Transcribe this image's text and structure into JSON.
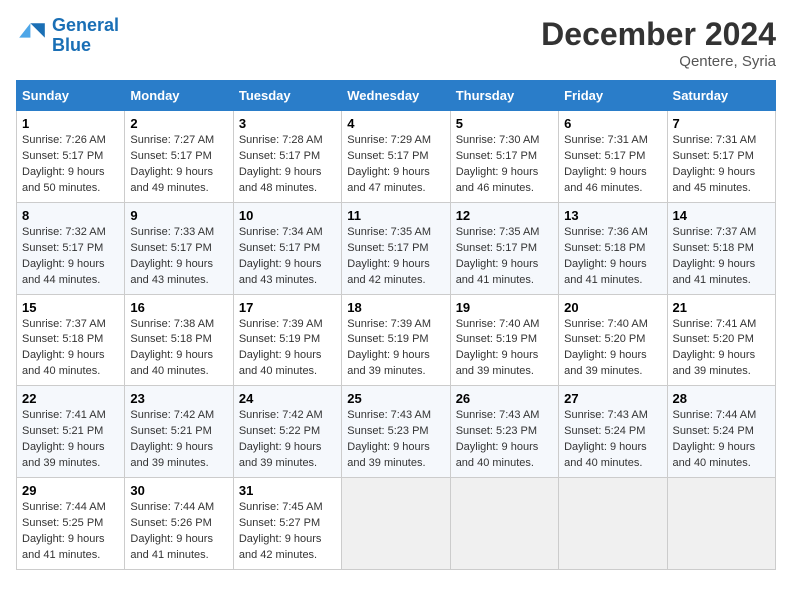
{
  "header": {
    "logo_line1": "General",
    "logo_line2": "Blue",
    "month": "December 2024",
    "location": "Qentere, Syria"
  },
  "columns": [
    "Sunday",
    "Monday",
    "Tuesday",
    "Wednesday",
    "Thursday",
    "Friday",
    "Saturday"
  ],
  "weeks": [
    [
      {
        "day": "1",
        "sunrise": "Sunrise: 7:26 AM",
        "sunset": "Sunset: 5:17 PM",
        "daylight": "Daylight: 9 hours and 50 minutes."
      },
      {
        "day": "2",
        "sunrise": "Sunrise: 7:27 AM",
        "sunset": "Sunset: 5:17 PM",
        "daylight": "Daylight: 9 hours and 49 minutes."
      },
      {
        "day": "3",
        "sunrise": "Sunrise: 7:28 AM",
        "sunset": "Sunset: 5:17 PM",
        "daylight": "Daylight: 9 hours and 48 minutes."
      },
      {
        "day": "4",
        "sunrise": "Sunrise: 7:29 AM",
        "sunset": "Sunset: 5:17 PM",
        "daylight": "Daylight: 9 hours and 47 minutes."
      },
      {
        "day": "5",
        "sunrise": "Sunrise: 7:30 AM",
        "sunset": "Sunset: 5:17 PM",
        "daylight": "Daylight: 9 hours and 46 minutes."
      },
      {
        "day": "6",
        "sunrise": "Sunrise: 7:31 AM",
        "sunset": "Sunset: 5:17 PM",
        "daylight": "Daylight: 9 hours and 46 minutes."
      },
      {
        "day": "7",
        "sunrise": "Sunrise: 7:31 AM",
        "sunset": "Sunset: 5:17 PM",
        "daylight": "Daylight: 9 hours and 45 minutes."
      }
    ],
    [
      {
        "day": "8",
        "sunrise": "Sunrise: 7:32 AM",
        "sunset": "Sunset: 5:17 PM",
        "daylight": "Daylight: 9 hours and 44 minutes."
      },
      {
        "day": "9",
        "sunrise": "Sunrise: 7:33 AM",
        "sunset": "Sunset: 5:17 PM",
        "daylight": "Daylight: 9 hours and 43 minutes."
      },
      {
        "day": "10",
        "sunrise": "Sunrise: 7:34 AM",
        "sunset": "Sunset: 5:17 PM",
        "daylight": "Daylight: 9 hours and 43 minutes."
      },
      {
        "day": "11",
        "sunrise": "Sunrise: 7:35 AM",
        "sunset": "Sunset: 5:17 PM",
        "daylight": "Daylight: 9 hours and 42 minutes."
      },
      {
        "day": "12",
        "sunrise": "Sunrise: 7:35 AM",
        "sunset": "Sunset: 5:17 PM",
        "daylight": "Daylight: 9 hours and 41 minutes."
      },
      {
        "day": "13",
        "sunrise": "Sunrise: 7:36 AM",
        "sunset": "Sunset: 5:18 PM",
        "daylight": "Daylight: 9 hours and 41 minutes."
      },
      {
        "day": "14",
        "sunrise": "Sunrise: 7:37 AM",
        "sunset": "Sunset: 5:18 PM",
        "daylight": "Daylight: 9 hours and 41 minutes."
      }
    ],
    [
      {
        "day": "15",
        "sunrise": "Sunrise: 7:37 AM",
        "sunset": "Sunset: 5:18 PM",
        "daylight": "Daylight: 9 hours and 40 minutes."
      },
      {
        "day": "16",
        "sunrise": "Sunrise: 7:38 AM",
        "sunset": "Sunset: 5:18 PM",
        "daylight": "Daylight: 9 hours and 40 minutes."
      },
      {
        "day": "17",
        "sunrise": "Sunrise: 7:39 AM",
        "sunset": "Sunset: 5:19 PM",
        "daylight": "Daylight: 9 hours and 40 minutes."
      },
      {
        "day": "18",
        "sunrise": "Sunrise: 7:39 AM",
        "sunset": "Sunset: 5:19 PM",
        "daylight": "Daylight: 9 hours and 39 minutes."
      },
      {
        "day": "19",
        "sunrise": "Sunrise: 7:40 AM",
        "sunset": "Sunset: 5:19 PM",
        "daylight": "Daylight: 9 hours and 39 minutes."
      },
      {
        "day": "20",
        "sunrise": "Sunrise: 7:40 AM",
        "sunset": "Sunset: 5:20 PM",
        "daylight": "Daylight: 9 hours and 39 minutes."
      },
      {
        "day": "21",
        "sunrise": "Sunrise: 7:41 AM",
        "sunset": "Sunset: 5:20 PM",
        "daylight": "Daylight: 9 hours and 39 minutes."
      }
    ],
    [
      {
        "day": "22",
        "sunrise": "Sunrise: 7:41 AM",
        "sunset": "Sunset: 5:21 PM",
        "daylight": "Daylight: 9 hours and 39 minutes."
      },
      {
        "day": "23",
        "sunrise": "Sunrise: 7:42 AM",
        "sunset": "Sunset: 5:21 PM",
        "daylight": "Daylight: 9 hours and 39 minutes."
      },
      {
        "day": "24",
        "sunrise": "Sunrise: 7:42 AM",
        "sunset": "Sunset: 5:22 PM",
        "daylight": "Daylight: 9 hours and 39 minutes."
      },
      {
        "day": "25",
        "sunrise": "Sunrise: 7:43 AM",
        "sunset": "Sunset: 5:23 PM",
        "daylight": "Daylight: 9 hours and 39 minutes."
      },
      {
        "day": "26",
        "sunrise": "Sunrise: 7:43 AM",
        "sunset": "Sunset: 5:23 PM",
        "daylight": "Daylight: 9 hours and 40 minutes."
      },
      {
        "day": "27",
        "sunrise": "Sunrise: 7:43 AM",
        "sunset": "Sunset: 5:24 PM",
        "daylight": "Daylight: 9 hours and 40 minutes."
      },
      {
        "day": "28",
        "sunrise": "Sunrise: 7:44 AM",
        "sunset": "Sunset: 5:24 PM",
        "daylight": "Daylight: 9 hours and 40 minutes."
      }
    ],
    [
      {
        "day": "29",
        "sunrise": "Sunrise: 7:44 AM",
        "sunset": "Sunset: 5:25 PM",
        "daylight": "Daylight: 9 hours and 41 minutes."
      },
      {
        "day": "30",
        "sunrise": "Sunrise: 7:44 AM",
        "sunset": "Sunset: 5:26 PM",
        "daylight": "Daylight: 9 hours and 41 minutes."
      },
      {
        "day": "31",
        "sunrise": "Sunrise: 7:45 AM",
        "sunset": "Sunset: 5:27 PM",
        "daylight": "Daylight: 9 hours and 42 minutes."
      },
      null,
      null,
      null,
      null
    ]
  ]
}
